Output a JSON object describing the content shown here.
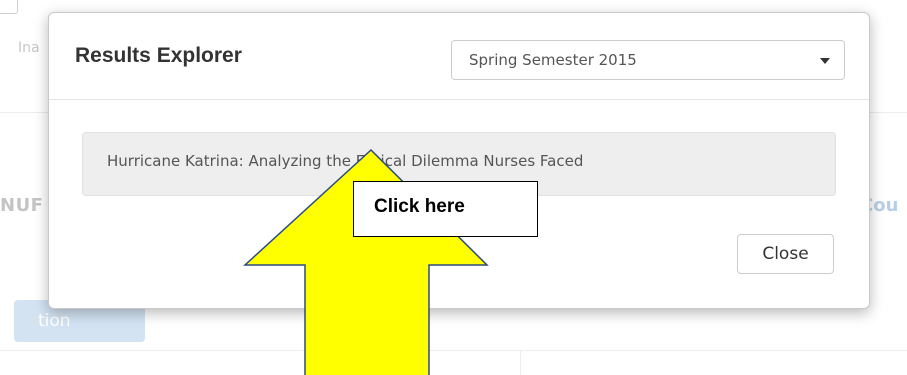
{
  "background": {
    "tab_label": "Ina",
    "left_label": "NUF",
    "right_label": "Cou",
    "button_label": "tion"
  },
  "modal": {
    "title": "Results Explorer",
    "semester_select": {
      "selected": "Spring Semester 2015"
    },
    "result_item": "Hurricane Katrina: Analyzing the Ethical Dilemma Nurses Faced",
    "close_label": "Close"
  },
  "annotation": {
    "callout_text": "Click here",
    "arrow_color": "#ffff00"
  }
}
